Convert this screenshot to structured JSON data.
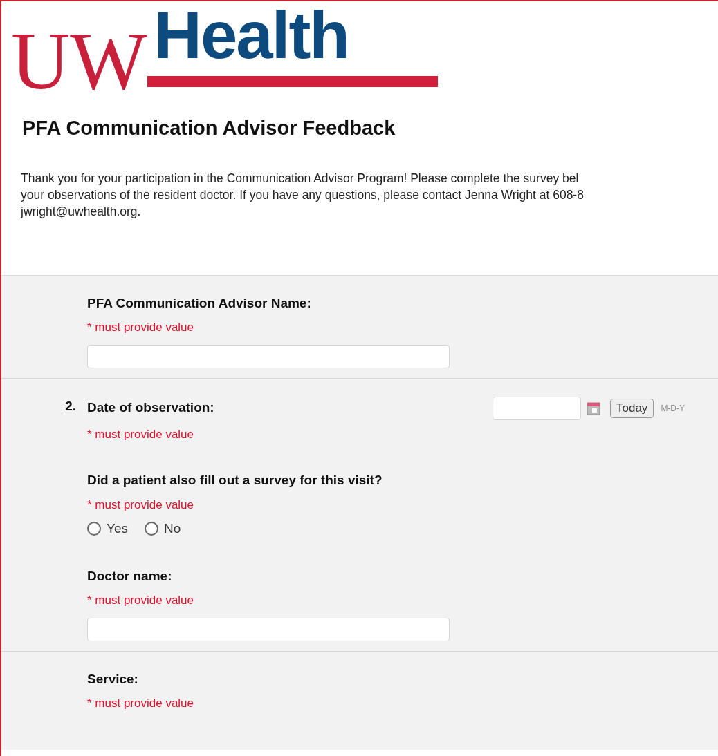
{
  "logo": {
    "part_1": "UW",
    "part_2": "Health"
  },
  "title": "PFA Communication Advisor Feedback",
  "intro": [
    "Thank you for your participation in the Communication Advisor Program! Please complete the survey bel",
    "your observations of the resident doctor. If you have any questions, please contact Jenna Wright at 608-8",
    "jwright@uwhealth.org."
  ],
  "questions": [
    {
      "kind": "text",
      "label": "PFA Communication Advisor Name:",
      "required": "* must provide value"
    },
    {
      "kind": "date",
      "number": "2.",
      "label": "Date of observation:",
      "required": "* must provide value",
      "divider": true,
      "button": "Today",
      "format": "M-D-Y"
    },
    {
      "kind": "radio",
      "label": "Did a patient also fill out a survey for this visit?",
      "required": "* must provide value",
      "options": [
        {
          "label": "Yes",
          "selected": false
        },
        {
          "label": "No",
          "selected": false
        }
      ]
    },
    {
      "kind": "text",
      "label": "Doctor name:",
      "required": "* must provide value"
    },
    {
      "kind": "blank",
      "label": "Service:",
      "required": "* must provide value",
      "divider": true
    }
  ]
}
